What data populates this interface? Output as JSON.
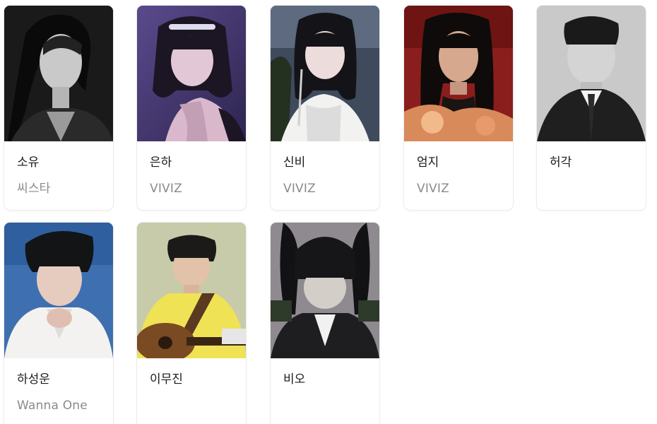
{
  "artists": [
    {
      "name": "소유",
      "group": "씨스타",
      "photo_icon": "portrait-bw-woman"
    },
    {
      "name": "은하",
      "group": "VIVIZ",
      "photo_icon": "portrait-purple-woman"
    },
    {
      "name": "신비",
      "group": "VIVIZ",
      "photo_icon": "portrait-white-woman"
    },
    {
      "name": "엄지",
      "group": "VIVIZ",
      "photo_icon": "portrait-red-woman"
    },
    {
      "name": "허각",
      "group": "",
      "photo_icon": "portrait-bw-man-suit"
    },
    {
      "name": "하성운",
      "group": "Wanna One",
      "photo_icon": "portrait-blue-man"
    },
    {
      "name": "이무진",
      "group": "",
      "photo_icon": "portrait-guitar-man"
    },
    {
      "name": "비오",
      "group": "",
      "photo_icon": "portrait-beanie-man"
    }
  ],
  "colors": {
    "name_text": "#1b1b1b",
    "group_text": "#8a8a8a",
    "card_border": "#ececec"
  }
}
